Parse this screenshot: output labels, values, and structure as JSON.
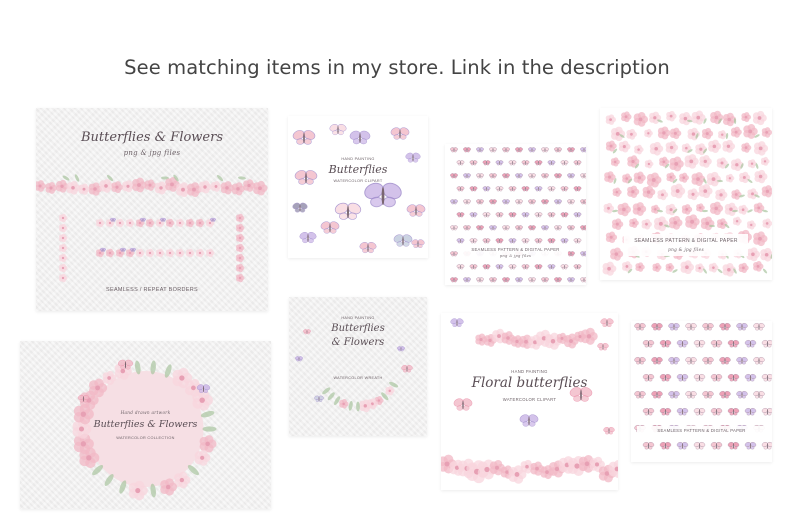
{
  "headline": "See matching items in my store. Link in the description",
  "colors": {
    "pink": "#f2b8c6",
    "rose": "#e98aa5",
    "blush": "#f8d6de",
    "lavender": "#c9b3e6",
    "purple": "#9b86c9",
    "leaf": "#a9c4a0",
    "text": "#5a4e55"
  },
  "cards": {
    "borders": {
      "title": "Butterflies & Flowers",
      "subtitle": "png & jpg files",
      "caption": "SEAMLESS / REPEAT BORDERS"
    },
    "butterflies": {
      "kicker": "HAND PAINTING",
      "title": "Butterflies",
      "caption": "WATERCOLOR CLIPART"
    },
    "pattern1": {
      "caption": "SEAMLESS PATTERN & DIGITAL PAPER",
      "subcaption": "png & jpg files"
    },
    "pattern2": {
      "caption": "SEAMLESS PATTERN & DIGITAL PAPER",
      "subcaption": "png & jpg files"
    },
    "wreath_frame": {
      "kicker": "Hand drawn artwork",
      "title": "Butterflies & Flowers",
      "caption": "WATERCOLOR COLLECTION"
    },
    "wreath": {
      "kicker": "HAND PAINTING",
      "title": "Butterflies",
      "title2": "& Flowers",
      "caption": "WATERCOLOR WREATH"
    },
    "floral": {
      "kicker": "HAND PAINTING",
      "title": "Floral butterflies",
      "caption": "WATERCOLOR CLIPART"
    },
    "pattern3": {
      "caption": "SEAMLESS PATTERN & DIGITAL PAPER"
    }
  }
}
